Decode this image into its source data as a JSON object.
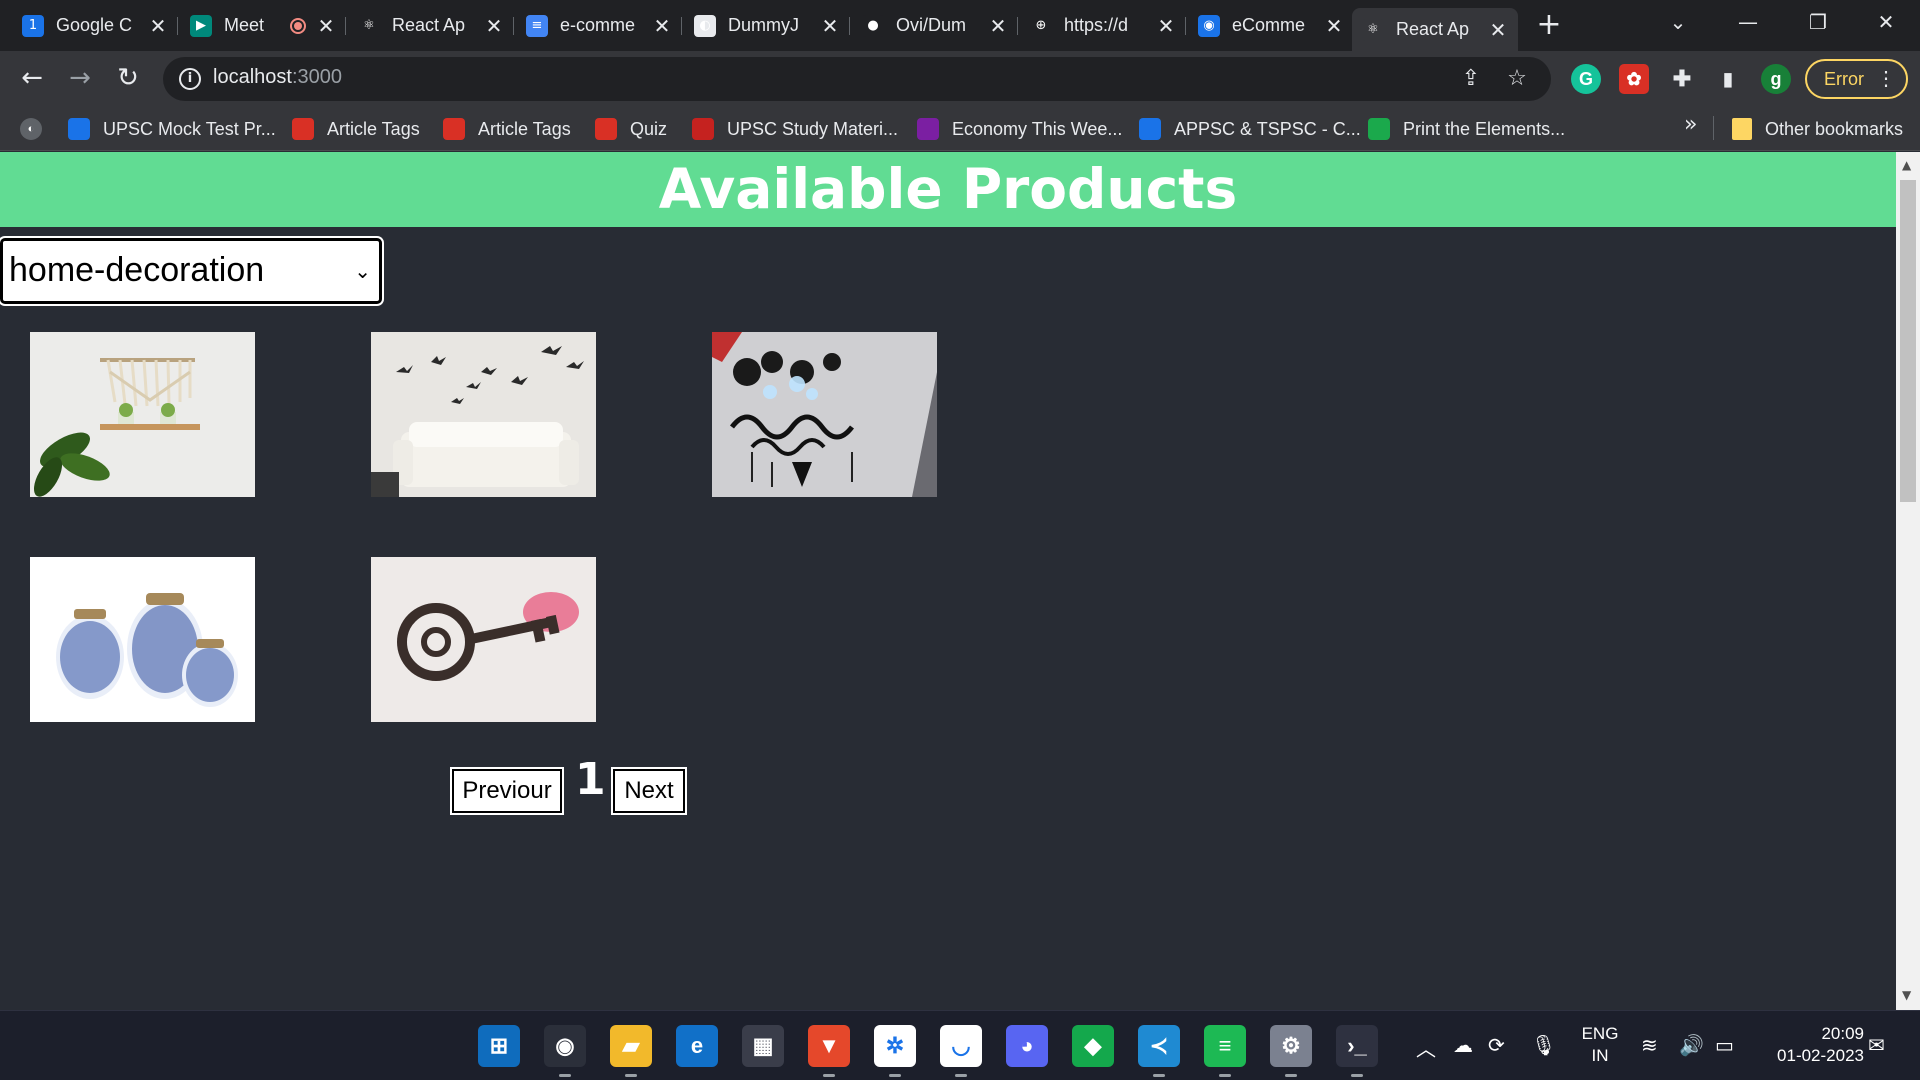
{
  "browser": {
    "tabs": [
      {
        "title": "Google C",
        "icon": "calendar-icon",
        "color": "#1a73e8",
        "glyph": "1"
      },
      {
        "title": "Meet",
        "icon": "meet-icon",
        "color": "#00897b",
        "glyph": "▶",
        "recording": true
      },
      {
        "title": "React Ap",
        "icon": "react-icon",
        "color": "#202124",
        "glyph": "⚛"
      },
      {
        "title": "e-comme",
        "icon": "docs-icon",
        "color": "#4285f4",
        "glyph": "≡"
      },
      {
        "title": "DummyJ",
        "icon": "dummyjson-icon",
        "color": "#e8eaed",
        "glyph": "◐"
      },
      {
        "title": "Ovi/Dum",
        "icon": "github-icon",
        "color": "#202124",
        "glyph": "●"
      },
      {
        "title": "https://d",
        "icon": "globe-icon",
        "color": "#202124",
        "glyph": "⊕"
      },
      {
        "title": "eComme",
        "icon": "ecommerce-icon",
        "color": "#1a73e8",
        "glyph": "◉"
      },
      {
        "title": "React Ap",
        "icon": "react-icon",
        "color": "#35363a",
        "glyph": "⚛",
        "active": true
      }
    ],
    "url_host": "localhost",
    "url_port": ":3000",
    "error_label": "Error",
    "profile_letter": "g",
    "bookmarks": [
      {
        "label": "UPSC Mock Test Pr...",
        "icon": "testbook-icon",
        "color": "#1a73e8"
      },
      {
        "label": "Article Tags",
        "icon": "tag-icon",
        "color": "#d93025"
      },
      {
        "label": "Article Tags",
        "icon": "tag-icon",
        "color": "#d93025"
      },
      {
        "label": "Quiz",
        "icon": "quiz-icon",
        "color": "#d93025"
      },
      {
        "label": "UPSC Study Materi...",
        "icon": "study-icon",
        "color": "#c5221f"
      },
      {
        "label": "Economy This Wee...",
        "icon": "bookmark-b-icon",
        "color": "#7b1fa2"
      },
      {
        "label": "APPSC & TSPSC - C...",
        "icon": "testbook-icon",
        "color": "#1a73e8"
      },
      {
        "label": "Print the Elements...",
        "icon": "hackerrank-icon",
        "color": "#1ba94c"
      }
    ],
    "bookmarks_more": "»",
    "other_bookmarks": "Other bookmarks"
  },
  "page": {
    "title": "Available Products",
    "category_selected": "home-decoration",
    "products": [
      {
        "name": "macrame-shelf",
        "row": 0,
        "col": 0
      },
      {
        "name": "wall-decal-birds",
        "row": 0,
        "col": 1
      },
      {
        "name": "led-wall-lamp",
        "row": 0,
        "col": 2
      },
      {
        "name": "ceramic-jars",
        "row": 1,
        "col": 0
      },
      {
        "name": "key-holder",
        "row": 1,
        "col": 1
      }
    ],
    "prev_label": "Previour",
    "page_number": "1",
    "next_label": "Next"
  },
  "taskbar": {
    "apps": [
      "windows-start-icon",
      "chrome-icon",
      "file-explorer-icon",
      "edge-icon",
      "ms-store-icon",
      "brave-icon",
      "slack-icon",
      "testbook-icon",
      "discord-icon",
      "evernote-icon",
      "vscode-icon",
      "spotify-icon",
      "settings-icon",
      "terminal-icon"
    ],
    "lang_top": "ENG",
    "lang_bottom": "IN",
    "time": "20:09",
    "date": "01-02-2023"
  }
}
